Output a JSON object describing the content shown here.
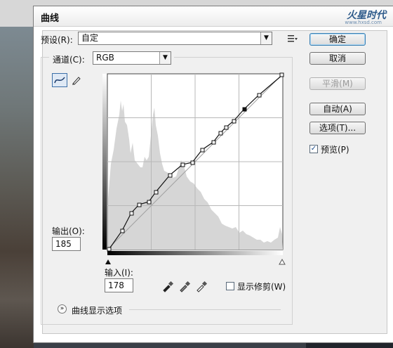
{
  "window": {
    "title": "曲线",
    "logo_text": "火星时代",
    "logo_sub": "www.hxsd.com"
  },
  "preset": {
    "label": "预设(R):",
    "value": "自定",
    "menu_icon": "preset-options-icon"
  },
  "channel": {
    "label": "通道(C):",
    "value": "RGB"
  },
  "buttons": {
    "ok": "确定",
    "cancel": "取消",
    "smooth": "平滑(M)",
    "auto": "自动(A)",
    "options": "选项(T)..."
  },
  "preview": {
    "label": "预览(P)",
    "checked": true
  },
  "output": {
    "label": "输出(O):",
    "value": "185"
  },
  "input": {
    "label": "输入(I):",
    "value": "178"
  },
  "show_clipping": {
    "label": "显示修剪(W)",
    "checked": false
  },
  "curve_display_options": {
    "label": "曲线显示选项"
  },
  "tools": [
    "curve-point-tool-icon",
    "pencil-tool-icon"
  ],
  "eyedroppers": [
    "black-point-eyedropper-icon",
    "gray-point-eyedropper-icon",
    "white-point-eyedropper-icon"
  ]
}
